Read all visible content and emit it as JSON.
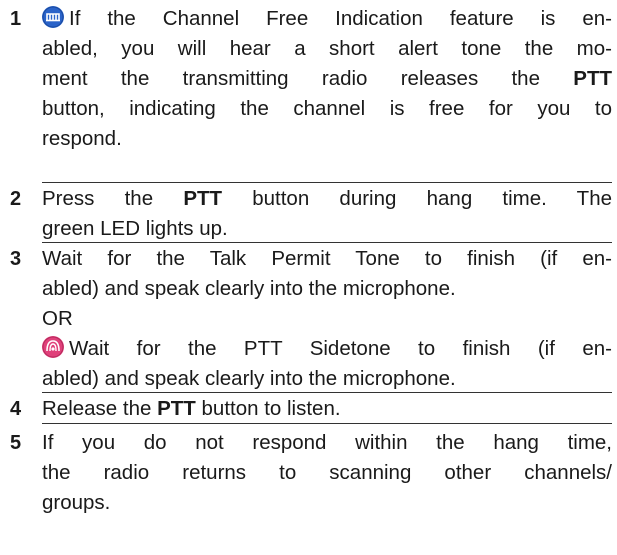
{
  "steps": [
    {
      "number": "1",
      "icon": "blue-digital-mode-icon",
      "lines": [
        "If the Channel Free Indication feature is en-",
        "abled, you will hear a short alert tone the mo-",
        "ment the transmitting radio releases the ",
        "button, indicating the channel is free for you to",
        "respond."
      ],
      "bold": "PTT"
    },
    {
      "number": "2",
      "lines_a": "Press the ",
      "bold": "PTT",
      "lines_b": " button during hang time. The",
      "line2": "green LED lights up."
    },
    {
      "number": "3",
      "line1": "Wait for the Talk Permit Tone to finish (if en-",
      "line2": "abled) and speak clearly into the microphone.",
      "or": "OR",
      "icon": "pink-analog-mode-icon",
      "line4": "Wait for the PTT Sidetone to finish (if en-",
      "line5": "abled) and speak clearly into the microphone."
    },
    {
      "number": "4",
      "lines_a": "Release the ",
      "bold": "PTT",
      "lines_b": " button to listen."
    },
    {
      "number": "5",
      "line1": "If you do not respond within the hang time,",
      "line2": "the radio returns to scanning other channels/",
      "line3": "groups."
    }
  ],
  "colors": {
    "digital_icon": "#2a63c9",
    "analog_icon": "#e0407a",
    "text": "#1a1a1a",
    "rule": "#333333"
  }
}
